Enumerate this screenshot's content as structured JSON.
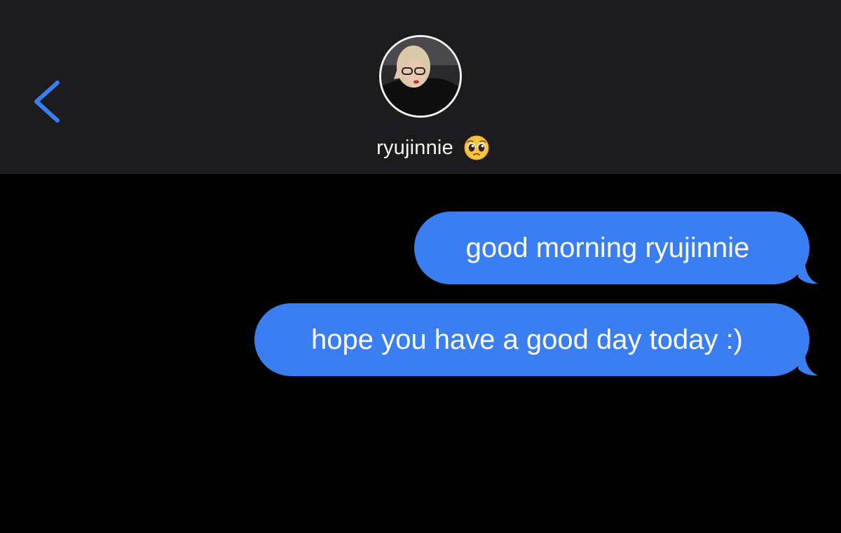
{
  "header": {
    "back_icon": "chevron-left-icon",
    "contact_name": "ryujinnie",
    "contact_emoji": "pleading-face-emoji",
    "accent_color": "#3a7ef2",
    "background_color": "#1c1c1e"
  },
  "thread": {
    "background_color": "#000000",
    "bubble_color": "#3a7ef2",
    "messages": [
      {
        "direction": "sent",
        "text": "good morning ryujinnie"
      },
      {
        "direction": "sent",
        "text": "hope you have a good day today :)"
      }
    ]
  }
}
